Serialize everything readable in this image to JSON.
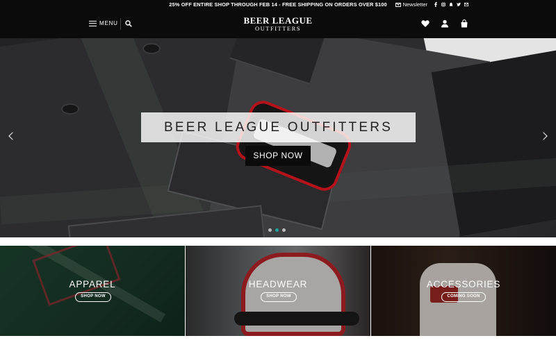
{
  "topbar": {
    "promo": "25% OFF ENTIRE SHOP THROUGH FEB 14 - FREE SHIPPING ON ORDERS OVER $100",
    "newsletter": "Newsletter",
    "social_icons": [
      "facebook-icon",
      "instagram-icon",
      "snapchat-icon",
      "twitter-icon",
      "email-icon"
    ]
  },
  "header": {
    "menu_label": "MENU",
    "logo_line1": "BEER LEAGUE",
    "logo_line2": "OUTFITTERS",
    "icons": [
      "heart-icon",
      "account-icon",
      "cart-icon"
    ]
  },
  "hero": {
    "title": "BEER LEAGUE OUTFITTERS",
    "button": "SHOP NOW",
    "slides_total": 3,
    "active_slide": 2
  },
  "tiles": [
    {
      "name": "APPAREL",
      "button": "SHOP NOW"
    },
    {
      "name": "HEADWEAR",
      "button": "SHOP NOW"
    },
    {
      "name": "ACCESSORIES",
      "button": "COMING SOON"
    }
  ],
  "colors": {
    "bar": "#0b0b0b",
    "active_dot": "#1fa39a"
  }
}
